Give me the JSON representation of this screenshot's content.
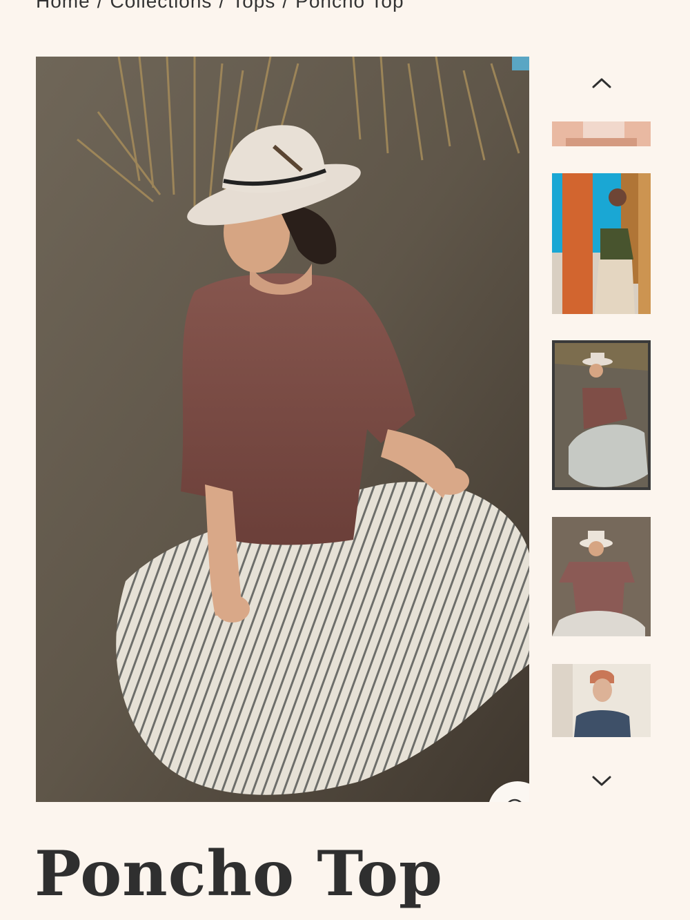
{
  "breadcrumb": {
    "items": [
      "Home",
      "Collections",
      "Tops",
      "Poncho Top"
    ],
    "separator": "/"
  },
  "product": {
    "title": "Poncho Top"
  },
  "gallery": {
    "main_image": "woman in hat and brown top sitting on sand dune with striped skirt",
    "zoom_icon": "search-icon",
    "up_icon": "chevron-up-icon",
    "down_icon": "chevron-down-icon",
    "thumbnails": [
      {
        "id": 1,
        "desc": "pink fabric crop",
        "selected": false
      },
      {
        "id": 2,
        "desc": "woman by orange pillar",
        "selected": false
      },
      {
        "id": 3,
        "desc": "woman seated on sand dune",
        "selected": true
      },
      {
        "id": 4,
        "desc": "woman lying on sand",
        "selected": false
      },
      {
        "id": 5,
        "desc": "woman with head wrap indoors",
        "selected": false
      }
    ]
  },
  "colors": {
    "background": "#fcf5ee",
    "text": "#2f2f2f",
    "selected_border": "#3a3a3a"
  }
}
